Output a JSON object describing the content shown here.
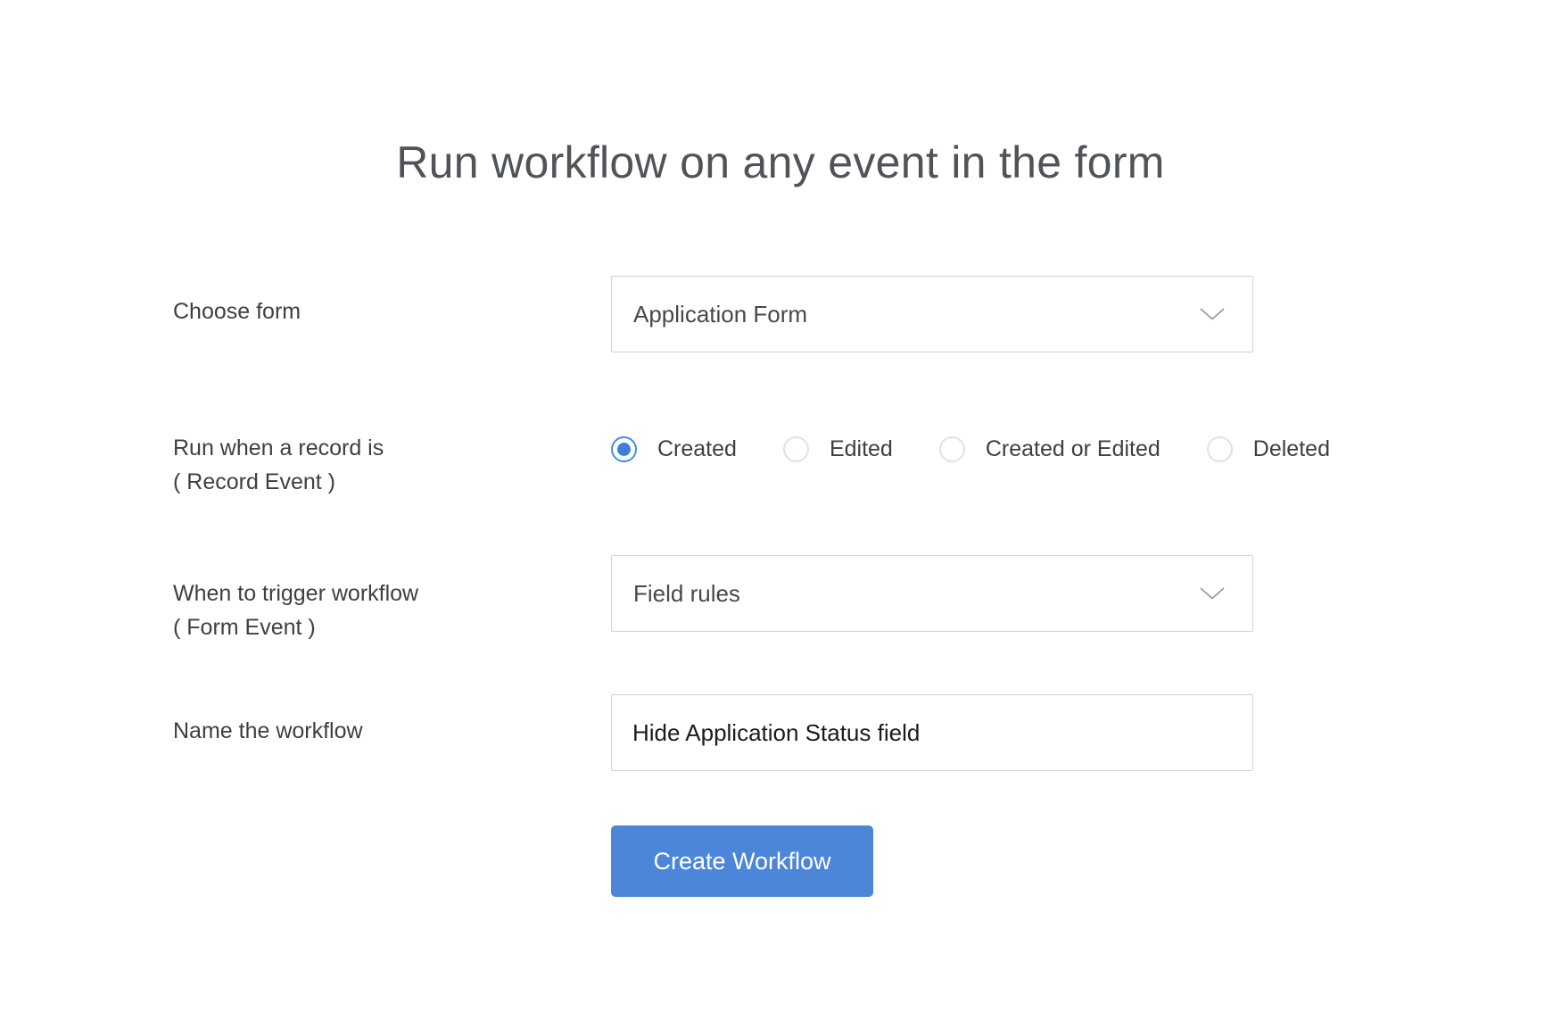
{
  "title": "Run workflow on any event in the form",
  "choose_form": {
    "label": "Choose form",
    "value": "Application Form"
  },
  "record_event": {
    "label_line1": "Run when a record is",
    "label_line2": "( Record Event )",
    "options": [
      {
        "label": "Created",
        "selected": true
      },
      {
        "label": "Edited",
        "selected": false
      },
      {
        "label": "Created or Edited",
        "selected": false
      },
      {
        "label": "Deleted",
        "selected": false
      }
    ]
  },
  "form_event": {
    "label_line1": "When to trigger workflow",
    "label_line2": "( Form Event )",
    "value": "Field rules"
  },
  "workflow_name": {
    "label": "Name the workflow",
    "value": "Hide Application Status field"
  },
  "actions": {
    "create_button": "Create Workflow"
  },
  "colors": {
    "accent_blue": "#4b86d8",
    "radio_selected_blue": "#3c80de",
    "border_gray": "#d2d2d4",
    "title_text": "#505458",
    "label_text": "#3d4043",
    "field_text": "#46494c",
    "input_text": "#1a1b1d",
    "button_text": "#ffffff"
  }
}
